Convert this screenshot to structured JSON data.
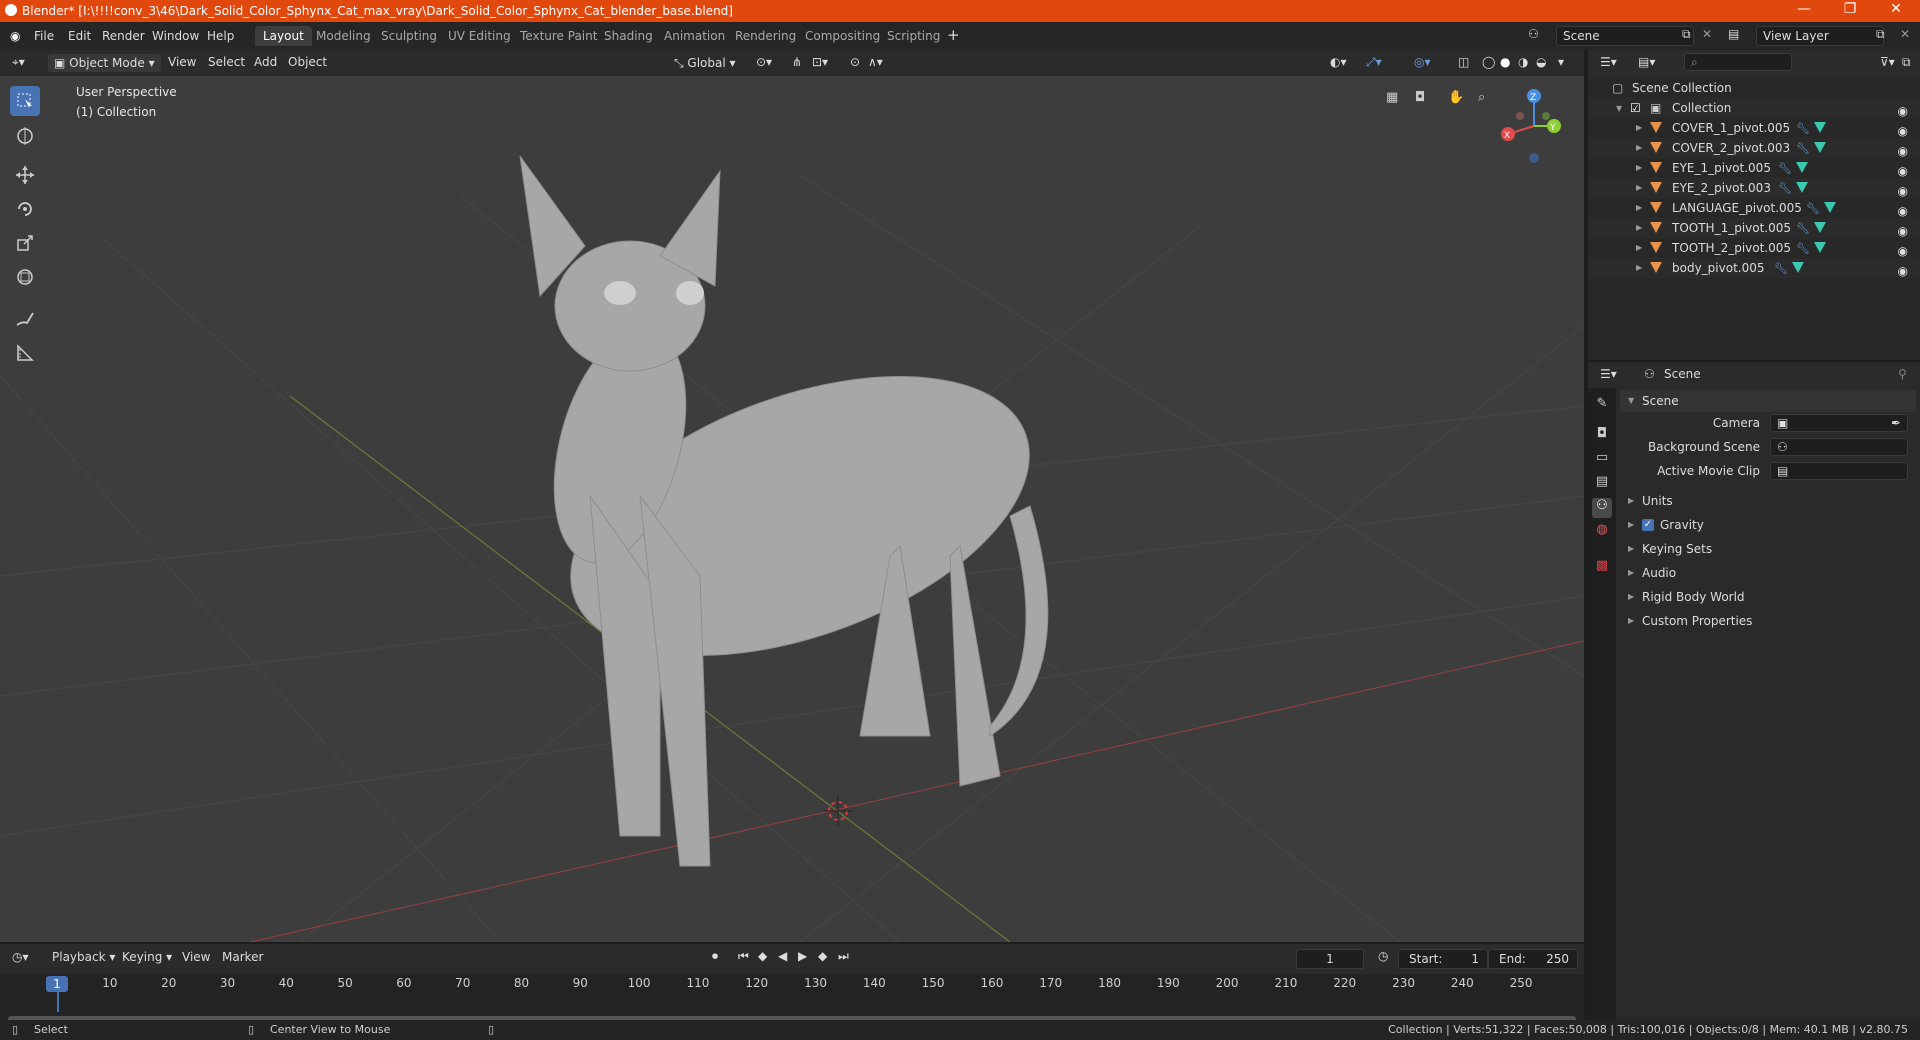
{
  "window": {
    "title": "Blender* [I:\\!!!!conv_3\\46\\Dark_Solid_Color_Sphynx_Cat_max_vray\\Dark_Solid_Color_Sphynx_Cat_blender_base.blend]"
  },
  "menu": [
    "File",
    "Edit",
    "Render",
    "Window",
    "Help"
  ],
  "workspaces": [
    "Layout",
    "Modeling",
    "Sculpting",
    "UV Editing",
    "Texture Paint",
    "Shading",
    "Animation",
    "Rendering",
    "Compositing",
    "Scripting"
  ],
  "active_workspace": "Layout",
  "scene_field": "Scene",
  "view_layer_field": "View Layer",
  "viewport_header": {
    "mode": "Object Mode",
    "items": [
      "View",
      "Select",
      "Add",
      "Object"
    ],
    "transform_orientation": "Global"
  },
  "viewport": {
    "perspective_label": "User Perspective",
    "collection_label": "(1) Collection",
    "gizmo_axes": [
      "X",
      "Y",
      "Z"
    ]
  },
  "outliner": {
    "root": "Scene Collection",
    "collection": "Collection",
    "objects": [
      "COVER_1_pivot.005",
      "COVER_2_pivot.003",
      "EYE_1_pivot.005",
      "EYE_2_pivot.003",
      "LANGUAGE_pivot.005",
      "TOOTH_1_pivot.005",
      "TOOTH_2_pivot.005",
      "body_pivot.005"
    ]
  },
  "properties": {
    "context": "Scene",
    "panel_title": "Scene",
    "camera_label": "Camera",
    "background_scene_label": "Background Scene",
    "active_movie_clip_label": "Active Movie Clip",
    "subpanels": [
      "Units",
      "Gravity",
      "Keying Sets",
      "Audio",
      "Rigid Body World",
      "Custom Properties"
    ],
    "gravity_checked": true
  },
  "timeline": {
    "menus": [
      "Playback",
      "Keying",
      "View",
      "Marker"
    ],
    "current_frame": "1",
    "start_label": "Start:",
    "start_value": "1",
    "end_label": "End:",
    "end_value": "250",
    "ticks": [
      "10",
      "20",
      "30",
      "40",
      "50",
      "60",
      "70",
      "80",
      "90",
      "100",
      "110",
      "120",
      "130",
      "140",
      "150",
      "160",
      "170",
      "180",
      "190",
      "200",
      "210",
      "220",
      "230",
      "240",
      "250"
    ],
    "playhead": "1"
  },
  "status": {
    "left": "Select",
    "middle": "Center View to Mouse",
    "right": "Collection | Verts:51,322 | Faces:50,008 | Tris:100,016 | Objects:0/8 | Mem: 40.1 MB | v2.80.75"
  },
  "colors": {
    "titlebar": "#e0480d",
    "accent": "#4772b3",
    "mesh_icon": "#e8924a",
    "data_icon": "#3cc7b0"
  }
}
